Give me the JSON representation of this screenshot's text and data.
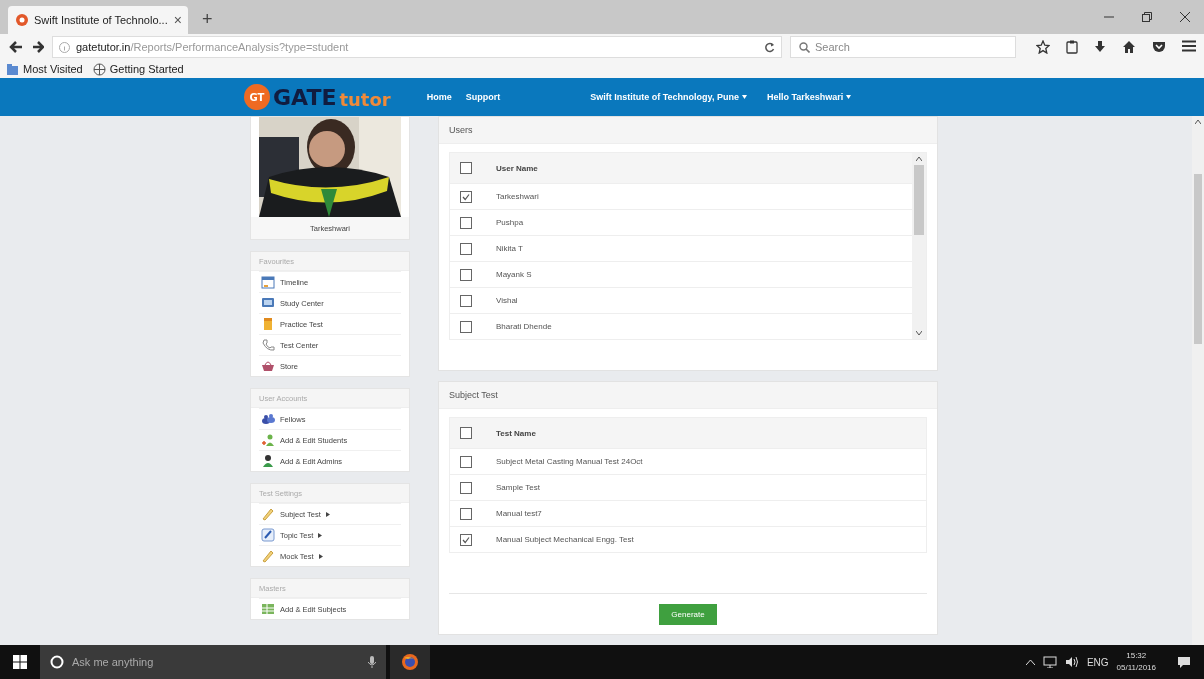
{
  "browser": {
    "tab_title": "Swift Institute of Technolo...",
    "tab_close": "×",
    "new_tab": "+",
    "url_host": "gatetutor.in",
    "url_path": "/Reports/PerformanceAnalysis?type=student",
    "search_placeholder": "Search",
    "bookmarks": [
      {
        "label": "Most Visited"
      },
      {
        "label": "Getting Started"
      }
    ]
  },
  "site_header": {
    "logo_badge": "GT",
    "logo_main": "GATE",
    "logo_accent": "tutor",
    "nav": [
      "Home",
      "Support"
    ],
    "institute": "Swift Institute of Technology, Pune",
    "greeting": "Hello Tarkeshwari"
  },
  "sidebar": {
    "profile_name": "Tarkeshwari",
    "sections": [
      {
        "title": "Favourites",
        "items": [
          {
            "label": "Timeline"
          },
          {
            "label": "Study Center"
          },
          {
            "label": "Practice Test"
          },
          {
            "label": "Test Center"
          },
          {
            "label": "Store"
          }
        ]
      },
      {
        "title": "User Accounts",
        "items": [
          {
            "label": "Fellows"
          },
          {
            "label": "Add & Edit Students"
          },
          {
            "label": "Add & Edit Admins"
          }
        ]
      },
      {
        "title": "Test Settings",
        "items": [
          {
            "label": "Subject Test",
            "submenu": true
          },
          {
            "label": "Topic Test",
            "submenu": true
          },
          {
            "label": "Mock Test",
            "submenu": true
          }
        ]
      },
      {
        "title": "Masters",
        "items": [
          {
            "label": "Add & Edit Subjects"
          }
        ]
      }
    ]
  },
  "users": {
    "title": "Users",
    "column": "User Name",
    "header_checked": false,
    "rows": [
      {
        "name": "Tarkeshwari",
        "checked": true
      },
      {
        "name": "Pushpa",
        "checked": false
      },
      {
        "name": "Nikita T",
        "checked": false
      },
      {
        "name": "Mayank S",
        "checked": false
      },
      {
        "name": "Vishal",
        "checked": false
      },
      {
        "name": "Bharati Dhende",
        "checked": false
      }
    ]
  },
  "subject_test": {
    "title": "Subject Test",
    "column": "Test Name",
    "header_checked": false,
    "rows": [
      {
        "name": "Subject Metal Casting Manual Test 24Oct",
        "checked": false
      },
      {
        "name": "Sample Test",
        "checked": false
      },
      {
        "name": "Manual test7",
        "checked": false
      },
      {
        "name": "Manual Subject Mechanical Engg. Test",
        "checked": true
      }
    ]
  },
  "generate_button": "Generate",
  "taskbar": {
    "search_placeholder": "Ask me anything",
    "language": "ENG",
    "time": "15:32",
    "date": "05/11/2016"
  }
}
